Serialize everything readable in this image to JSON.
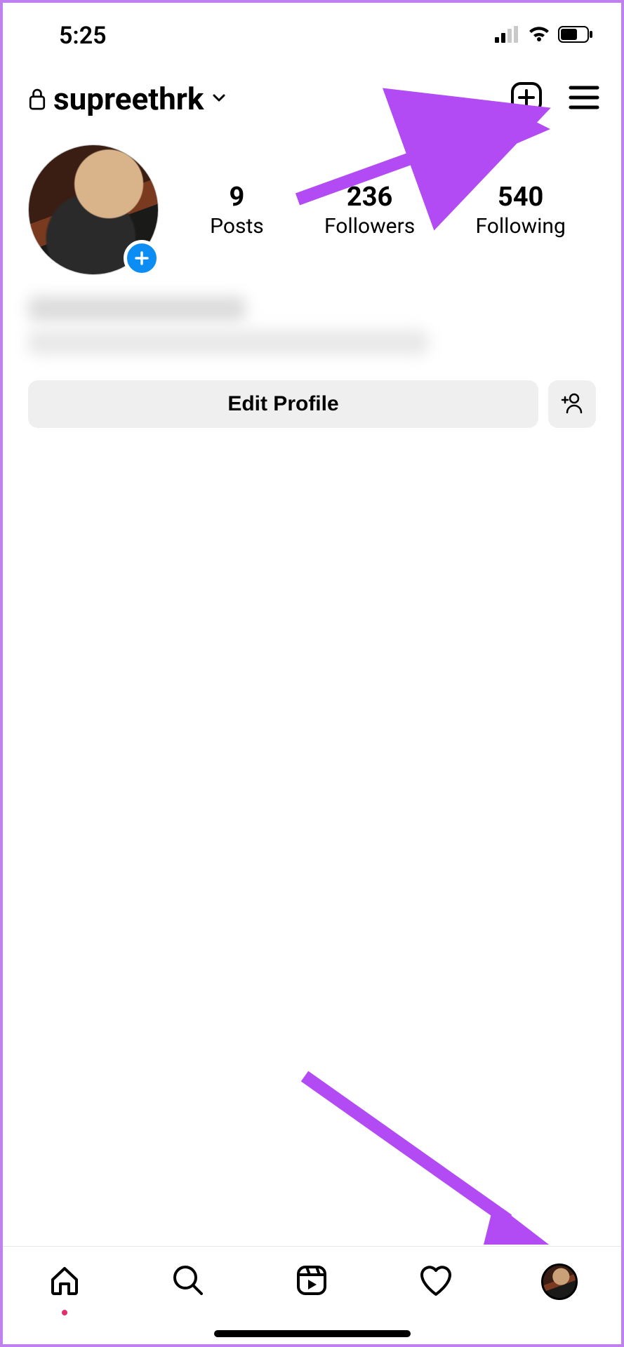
{
  "status_bar": {
    "time": "5:25"
  },
  "profile": {
    "username": "supreethrk",
    "privacy": "private",
    "stats": {
      "posts": {
        "count": "9",
        "label": "Posts"
      },
      "followers": {
        "count": "236",
        "label": "Followers"
      },
      "following": {
        "count": "540",
        "label": "Following"
      }
    },
    "edit_button_label": "Edit Profile"
  },
  "icons": {
    "lock": "lock-icon",
    "chevron_down": "chevron-down-icon",
    "new_post": "plus-square-icon",
    "menu": "hamburger-icon",
    "avatar_add": "plus-circle-icon",
    "discover_people": "add-user-icon",
    "home": "home-icon",
    "search": "search-icon",
    "reels": "reels-icon",
    "activity": "heart-icon",
    "profile": "profile-avatar-icon"
  },
  "annotation": {
    "arrow_color": "#b24bf3",
    "arrow1_target": "menu-button",
    "arrow2_target": "profile-tab"
  }
}
